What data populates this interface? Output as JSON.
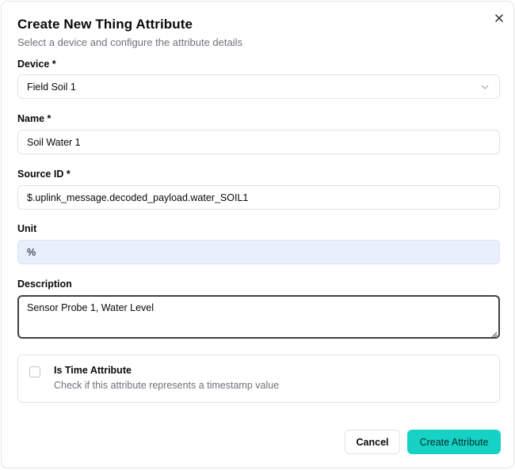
{
  "dialog": {
    "title": "Create New Thing Attribute",
    "subtitle": "Select a device and configure the attribute details",
    "close_icon": "close-icon"
  },
  "device": {
    "label": "Device *",
    "value": "Field Soil 1",
    "icon": "chevron-down-icon"
  },
  "name": {
    "label": "Name *",
    "value": "Soil Water 1"
  },
  "source_id": {
    "label": "Source ID *",
    "value": "$.uplink_message.decoded_payload.water_SOIL1"
  },
  "unit": {
    "label": "Unit",
    "value": "%"
  },
  "description": {
    "label": "Description",
    "value": "Sensor Probe 1, Water Level"
  },
  "time_attribute": {
    "title": "Is Time Attribute",
    "description": "Check if this attribute represents a timestamp value",
    "checked": false
  },
  "actions": {
    "cancel_label": "Cancel",
    "create_label": "Create Attribute"
  },
  "colors": {
    "accent": "#16d2c4",
    "highlight_field": "#e8effd",
    "muted_text": "#71717a"
  }
}
